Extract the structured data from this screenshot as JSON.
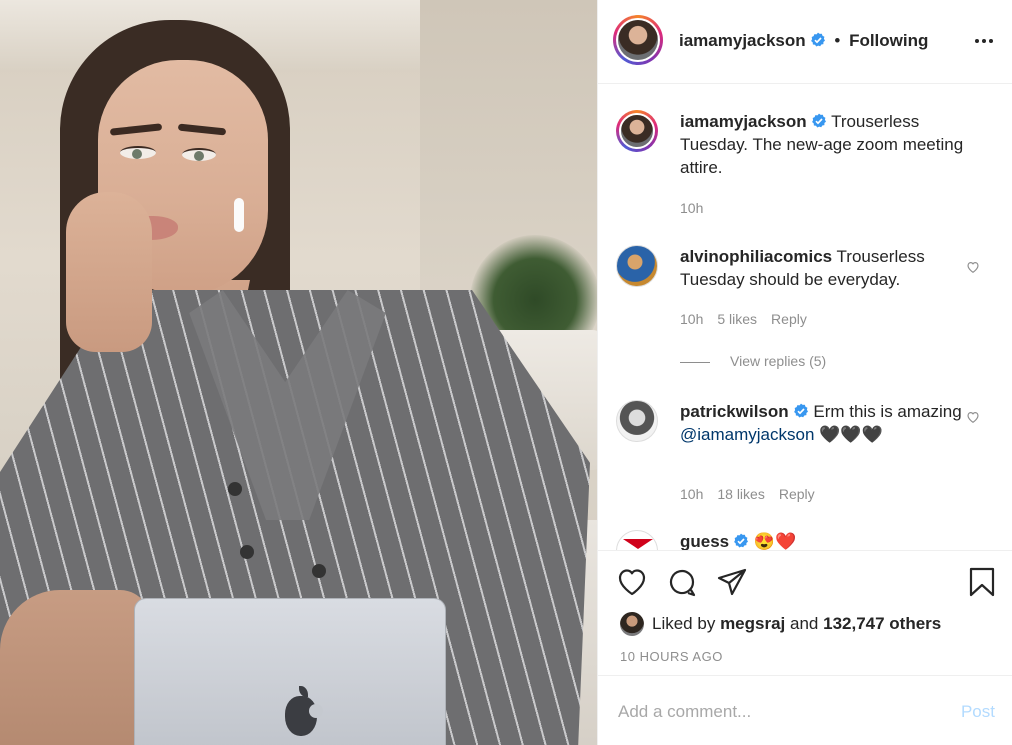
{
  "post": {
    "owner": {
      "username": "iamamyjackson",
      "verified": true
    },
    "follow_status": "Following",
    "separator": "•"
  },
  "comments": [
    {
      "username": "iamamyjackson",
      "verified": true,
      "text": "Trouserless Tuesday. The new-age zoom meeting attire.",
      "time": "10h"
    },
    {
      "username": "alvinophiliacomics",
      "verified": false,
      "text": "Trouserless Tuesday should be everyday.",
      "time": "10h",
      "likes": "5 likes",
      "reply_label": "Reply",
      "view_replies": "View replies (5)"
    },
    {
      "username": "patrickwilson",
      "verified": true,
      "text_before": "Erm this is amazing ",
      "mention": "@iamamyjackson",
      "emoji": "🖤🖤🖤",
      "time": "10h",
      "likes": "18 likes",
      "reply_label": "Reply"
    },
    {
      "username": "guess",
      "verified": true,
      "emoji": "😍❤️"
    }
  ],
  "actions": {
    "icons": [
      "heart-icon",
      "comment-icon",
      "share-icon",
      "bookmark-icon"
    ],
    "liked_prefix": "Liked by",
    "liked_user": "megsraj",
    "liked_and": "and",
    "liked_others": "132,747 others",
    "timestamp": "10 HOURS AGO"
  },
  "composer": {
    "placeholder": "Add a comment...",
    "post_label": "Post"
  },
  "colors": {
    "verified_blue": "#3897f0",
    "post_disabled": "#b3dbff",
    "muted_text": "#8e8e8e"
  }
}
